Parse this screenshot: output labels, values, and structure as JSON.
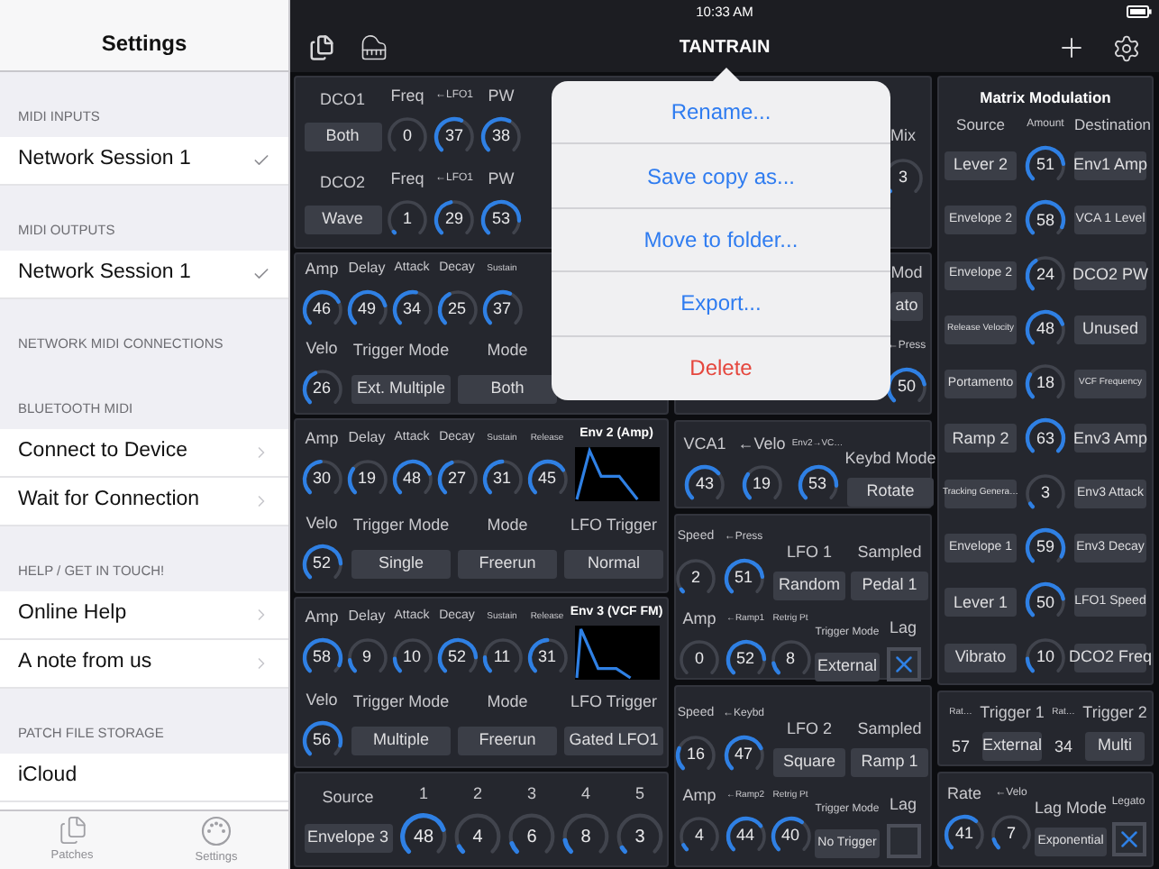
{
  "sidebar": {
    "title": "Settings",
    "sections": [
      {
        "header": "MIDI INPUTS",
        "rows": [
          {
            "label": "Network Session 1",
            "kind": "check",
            "checked": true
          }
        ]
      },
      {
        "header": "MIDI OUTPUTS",
        "rows": [
          {
            "label": "Network Session 1",
            "kind": "check",
            "checked": true
          }
        ]
      },
      {
        "header": "NETWORK MIDI CONNECTIONS"
      },
      {
        "header": "BLUETOOTH MIDI",
        "rows": [
          {
            "label": "Connect to Device",
            "kind": "link"
          },
          {
            "label": "Wait for Connection",
            "kind": "link"
          }
        ]
      },
      {
        "header": "HELP / GET IN TOUCH!",
        "rows": [
          {
            "label": "Online Help",
            "kind": "link"
          },
          {
            "label": "A note from us",
            "kind": "link"
          }
        ]
      },
      {
        "header": "PATCH FILE STORAGE",
        "rows": [
          {
            "label": "iCloud",
            "kind": "plain"
          }
        ]
      }
    ],
    "tabs": [
      {
        "label": "Patches",
        "kind": "patches"
      },
      {
        "label": "Settings",
        "kind": "settings"
      }
    ]
  },
  "toolbar": {
    "time": "10:33 AM",
    "title": "TANTRAIN"
  },
  "menu": [
    {
      "label": "Rename...",
      "destructive": false
    },
    {
      "label": "Save copy as...",
      "destructive": false
    },
    {
      "label": "Move to folder...",
      "destructive": false
    },
    {
      "label": "Export...",
      "destructive": false
    },
    {
      "label": "Delete",
      "destructive": true
    }
  ],
  "dco": {
    "rows": [
      {
        "name": "DCO1",
        "wave": "Both",
        "knobs": [
          {
            "label": "Freq",
            "value": "0"
          },
          {
            "label": "←LFO1",
            "value": "37"
          },
          {
            "label": "PW",
            "value": "38"
          }
        ]
      },
      {
        "name": "DCO2",
        "wave": "Wave",
        "knobs": [
          {
            "label": "Freq",
            "value": "1"
          },
          {
            "label": "←LFO1",
            "value": "29"
          },
          {
            "label": "PW",
            "value": "53"
          }
        ]
      }
    ],
    "mix": {
      "label": "Mix",
      "value": "3"
    }
  },
  "envelopes": [
    {
      "knobs": [
        {
          "label": "Amp",
          "value": "46"
        },
        {
          "label": "Delay",
          "value": "49"
        },
        {
          "label": "Attack",
          "value": "34"
        },
        {
          "label": "Decay",
          "value": "25"
        },
        {
          "label": "Sustain",
          "value": "37"
        }
      ],
      "velo": {
        "label": "Velo",
        "value": "26"
      },
      "selectors": [
        {
          "label": "Trigger Mode",
          "value": "Ext. Multiple"
        },
        {
          "label": "Mode",
          "value": "Both"
        }
      ]
    },
    {
      "title": "Env 2 (Amp)",
      "knobs": [
        {
          "label": "Amp",
          "value": "30"
        },
        {
          "label": "Delay",
          "value": "19"
        },
        {
          "label": "Attack",
          "value": "48"
        },
        {
          "label": "Decay",
          "value": "27"
        },
        {
          "label": "Sustain",
          "value": "31"
        },
        {
          "label": "Release",
          "value": "45"
        }
      ],
      "velo": {
        "label": "Velo",
        "value": "52"
      },
      "selectors": [
        {
          "label": "Trigger Mode",
          "value": "Single"
        },
        {
          "label": "Mode",
          "value": "Freerun"
        },
        {
          "label": "LFO Trigger",
          "value": "Normal"
        }
      ]
    },
    {
      "title": "Env 3 (VCF FM)",
      "knobs": [
        {
          "label": "Amp",
          "value": "58"
        },
        {
          "label": "Delay",
          "value": "9"
        },
        {
          "label": "Attack",
          "value": "10"
        },
        {
          "label": "Decay",
          "value": "52"
        },
        {
          "label": "Sustain",
          "value": "11"
        },
        {
          "label": "Release",
          "value": "31"
        }
      ],
      "velo": {
        "label": "Velo",
        "value": "56"
      },
      "selectors": [
        {
          "label": "Trigger Mode",
          "value": "Multiple"
        },
        {
          "label": "Mode",
          "value": "Freerun"
        },
        {
          "label": "LFO Trigger",
          "value": "Gated LFO1"
        }
      ]
    }
  ],
  "tracking": {
    "source_label": "Source",
    "source": "Envelope 3",
    "knobs": [
      {
        "label": "1",
        "value": "48"
      },
      {
        "label": "2",
        "value": "4"
      },
      {
        "label": "3",
        "value": "6"
      },
      {
        "label": "4",
        "value": "8"
      },
      {
        "label": "5",
        "value": "3"
      }
    ]
  },
  "mod": {
    "rows": [
      {
        "items": [
          {
            "kind": "button",
            "label": "Mod",
            "value": "ato"
          }
        ]
      },
      {
        "items": [
          {
            "kind": "knob",
            "label": "←Press",
            "value": "50"
          }
        ]
      }
    ]
  },
  "vca": {
    "rows": [
      {
        "items": [
          {
            "kind": "knob",
            "label": "VCA1",
            "value": "43"
          },
          {
            "kind": "knob",
            "label": "←Velo",
            "value": "19"
          },
          {
            "kind": "knob",
            "label": "Env2→VC…",
            "value": "53"
          },
          {
            "kind": "button",
            "label": "Keybd Mode",
            "value": "Rotate"
          }
        ]
      }
    ]
  },
  "lfo1": {
    "rows": [
      {
        "items": [
          {
            "kind": "knob",
            "label": "Speed",
            "value": "2"
          },
          {
            "kind": "knob",
            "label": "←Press",
            "value": "51"
          },
          {
            "kind": "button",
            "label": "LFO 1",
            "value": "Random"
          },
          {
            "kind": "button",
            "label": "Sampled",
            "value": "Pedal 1"
          }
        ]
      },
      {
        "items": [
          {
            "kind": "knob",
            "label": "Amp",
            "value": "0"
          },
          {
            "kind": "knob",
            "label": "←Ramp1",
            "value": "52"
          },
          {
            "kind": "knob",
            "label": "Retrig Pt",
            "value": "8"
          },
          {
            "kind": "button",
            "label": "Trigger Mode",
            "value": "External"
          },
          {
            "kind": "checkbox",
            "label": "Lag",
            "checked": true
          }
        ]
      }
    ]
  },
  "lfo2": {
    "rows": [
      {
        "items": [
          {
            "kind": "knob",
            "label": "Speed",
            "value": "16"
          },
          {
            "kind": "knob",
            "label": "←Keybd",
            "value": "47"
          },
          {
            "kind": "button",
            "label": "LFO 2",
            "value": "Square"
          },
          {
            "kind": "button",
            "label": "Sampled",
            "value": "Ramp 1"
          }
        ]
      },
      {
        "items": [
          {
            "kind": "knob",
            "label": "Amp",
            "value": "4"
          },
          {
            "kind": "knob",
            "label": "←Ramp2",
            "value": "44"
          },
          {
            "kind": "knob",
            "label": "Retrig Pt",
            "value": "40"
          },
          {
            "kind": "button",
            "label": "Trigger Mode",
            "value": "No Trigger"
          },
          {
            "kind": "checkbox",
            "label": "Lag",
            "checked": false
          }
        ]
      }
    ]
  },
  "matrix": {
    "title": "Matrix Modulation",
    "columns": [
      "Source",
      "Amount",
      "Destination"
    ],
    "rows": [
      {
        "source": "Lever 2",
        "value": "51",
        "destination": "Env1 Amp"
      },
      {
        "source": "Envelope 2",
        "value": "58",
        "destination": "VCA 1 Level"
      },
      {
        "source": "Envelope 2",
        "value": "24",
        "destination": "DCO2 PW"
      },
      {
        "source": "Release Velocity",
        "value": "48",
        "destination": "Unused"
      },
      {
        "source": "Portamento",
        "value": "18",
        "destination": "VCF Frequency"
      },
      {
        "source": "Ramp 2",
        "value": "63",
        "destination": "Env3 Amp"
      },
      {
        "source": "Tracking Genera…",
        "value": "3",
        "destination": "Env3 Attack"
      },
      {
        "source": "Envelope 1",
        "value": "59",
        "destination": "Env3 Decay"
      },
      {
        "source": "Lever 1",
        "value": "50",
        "destination": "LFO1 Speed"
      },
      {
        "source": "Vibrato",
        "value": "10",
        "destination": "DCO2 Freq"
      }
    ]
  },
  "triggers": {
    "rows": [
      {
        "items": [
          {
            "kind": "number",
            "label": "Rat…",
            "value": "57"
          },
          {
            "kind": "button",
            "label": "Trigger 1",
            "value": "External"
          },
          {
            "kind": "number",
            "label": "Rat…",
            "value": "34"
          },
          {
            "kind": "button",
            "label": "Trigger 2",
            "value": "Multi"
          }
        ]
      }
    ]
  },
  "glide": {
    "rows": [
      {
        "items": [
          {
            "kind": "knob",
            "label": "Rate",
            "value": "41"
          },
          {
            "kind": "knob",
            "label": "←Velo",
            "value": "7"
          },
          {
            "kind": "button",
            "label": "Lag Mode",
            "value": "Exponential"
          },
          {
            "kind": "checkbox",
            "label": "Legato",
            "checked": true
          }
        ]
      }
    ]
  }
}
